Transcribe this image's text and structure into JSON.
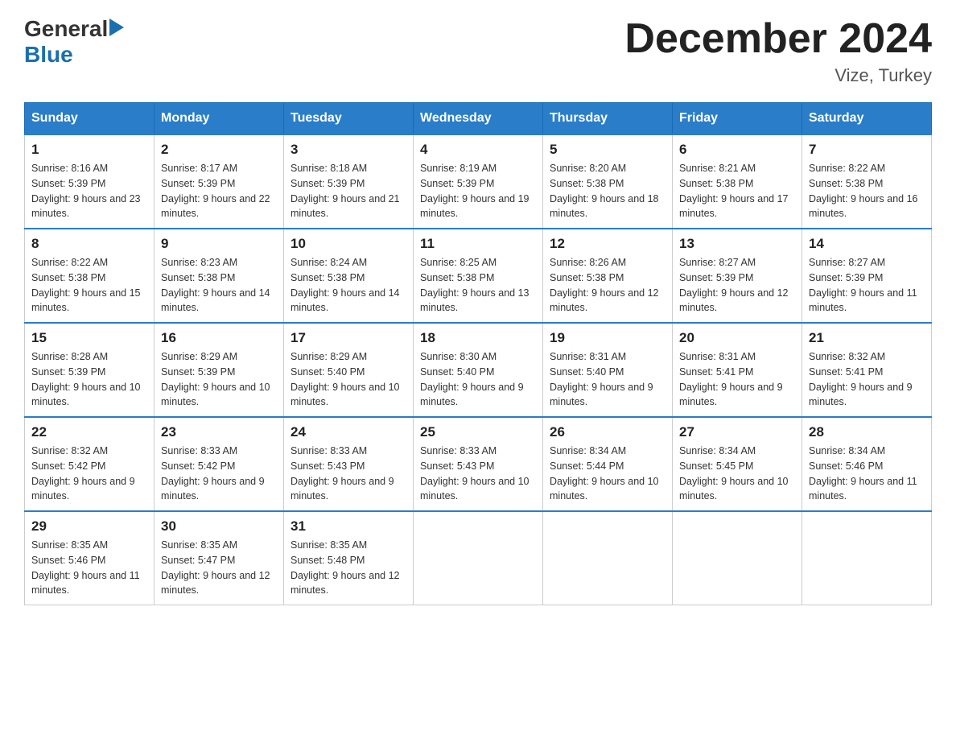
{
  "header": {
    "logo_general": "General",
    "logo_blue": "Blue",
    "main_title": "December 2024",
    "subtitle": "Vize, Turkey"
  },
  "days_of_week": [
    "Sunday",
    "Monday",
    "Tuesday",
    "Wednesday",
    "Thursday",
    "Friday",
    "Saturday"
  ],
  "weeks": [
    [
      {
        "day": "1",
        "sunrise": "8:16 AM",
        "sunset": "5:39 PM",
        "daylight": "9 hours and 23 minutes."
      },
      {
        "day": "2",
        "sunrise": "8:17 AM",
        "sunset": "5:39 PM",
        "daylight": "9 hours and 22 minutes."
      },
      {
        "day": "3",
        "sunrise": "8:18 AM",
        "sunset": "5:39 PM",
        "daylight": "9 hours and 21 minutes."
      },
      {
        "day": "4",
        "sunrise": "8:19 AM",
        "sunset": "5:39 PM",
        "daylight": "9 hours and 19 minutes."
      },
      {
        "day": "5",
        "sunrise": "8:20 AM",
        "sunset": "5:38 PM",
        "daylight": "9 hours and 18 minutes."
      },
      {
        "day": "6",
        "sunrise": "8:21 AM",
        "sunset": "5:38 PM",
        "daylight": "9 hours and 17 minutes."
      },
      {
        "day": "7",
        "sunrise": "8:22 AM",
        "sunset": "5:38 PM",
        "daylight": "9 hours and 16 minutes."
      }
    ],
    [
      {
        "day": "8",
        "sunrise": "8:22 AM",
        "sunset": "5:38 PM",
        "daylight": "9 hours and 15 minutes."
      },
      {
        "day": "9",
        "sunrise": "8:23 AM",
        "sunset": "5:38 PM",
        "daylight": "9 hours and 14 minutes."
      },
      {
        "day": "10",
        "sunrise": "8:24 AM",
        "sunset": "5:38 PM",
        "daylight": "9 hours and 14 minutes."
      },
      {
        "day": "11",
        "sunrise": "8:25 AM",
        "sunset": "5:38 PM",
        "daylight": "9 hours and 13 minutes."
      },
      {
        "day": "12",
        "sunrise": "8:26 AM",
        "sunset": "5:38 PM",
        "daylight": "9 hours and 12 minutes."
      },
      {
        "day": "13",
        "sunrise": "8:27 AM",
        "sunset": "5:39 PM",
        "daylight": "9 hours and 12 minutes."
      },
      {
        "day": "14",
        "sunrise": "8:27 AM",
        "sunset": "5:39 PM",
        "daylight": "9 hours and 11 minutes."
      }
    ],
    [
      {
        "day": "15",
        "sunrise": "8:28 AM",
        "sunset": "5:39 PM",
        "daylight": "9 hours and 10 minutes."
      },
      {
        "day": "16",
        "sunrise": "8:29 AM",
        "sunset": "5:39 PM",
        "daylight": "9 hours and 10 minutes."
      },
      {
        "day": "17",
        "sunrise": "8:29 AM",
        "sunset": "5:40 PM",
        "daylight": "9 hours and 10 minutes."
      },
      {
        "day": "18",
        "sunrise": "8:30 AM",
        "sunset": "5:40 PM",
        "daylight": "9 hours and 9 minutes."
      },
      {
        "day": "19",
        "sunrise": "8:31 AM",
        "sunset": "5:40 PM",
        "daylight": "9 hours and 9 minutes."
      },
      {
        "day": "20",
        "sunrise": "8:31 AM",
        "sunset": "5:41 PM",
        "daylight": "9 hours and 9 minutes."
      },
      {
        "day": "21",
        "sunrise": "8:32 AM",
        "sunset": "5:41 PM",
        "daylight": "9 hours and 9 minutes."
      }
    ],
    [
      {
        "day": "22",
        "sunrise": "8:32 AM",
        "sunset": "5:42 PM",
        "daylight": "9 hours and 9 minutes."
      },
      {
        "day": "23",
        "sunrise": "8:33 AM",
        "sunset": "5:42 PM",
        "daylight": "9 hours and 9 minutes."
      },
      {
        "day": "24",
        "sunrise": "8:33 AM",
        "sunset": "5:43 PM",
        "daylight": "9 hours and 9 minutes."
      },
      {
        "day": "25",
        "sunrise": "8:33 AM",
        "sunset": "5:43 PM",
        "daylight": "9 hours and 10 minutes."
      },
      {
        "day": "26",
        "sunrise": "8:34 AM",
        "sunset": "5:44 PM",
        "daylight": "9 hours and 10 minutes."
      },
      {
        "day": "27",
        "sunrise": "8:34 AM",
        "sunset": "5:45 PM",
        "daylight": "9 hours and 10 minutes."
      },
      {
        "day": "28",
        "sunrise": "8:34 AM",
        "sunset": "5:46 PM",
        "daylight": "9 hours and 11 minutes."
      }
    ],
    [
      {
        "day": "29",
        "sunrise": "8:35 AM",
        "sunset": "5:46 PM",
        "daylight": "9 hours and 11 minutes."
      },
      {
        "day": "30",
        "sunrise": "8:35 AM",
        "sunset": "5:47 PM",
        "daylight": "9 hours and 12 minutes."
      },
      {
        "day": "31",
        "sunrise": "8:35 AM",
        "sunset": "5:48 PM",
        "daylight": "9 hours and 12 minutes."
      },
      null,
      null,
      null,
      null
    ]
  ],
  "labels": {
    "sunrise_prefix": "Sunrise: ",
    "sunset_prefix": "Sunset: ",
    "daylight_prefix": "Daylight: "
  }
}
